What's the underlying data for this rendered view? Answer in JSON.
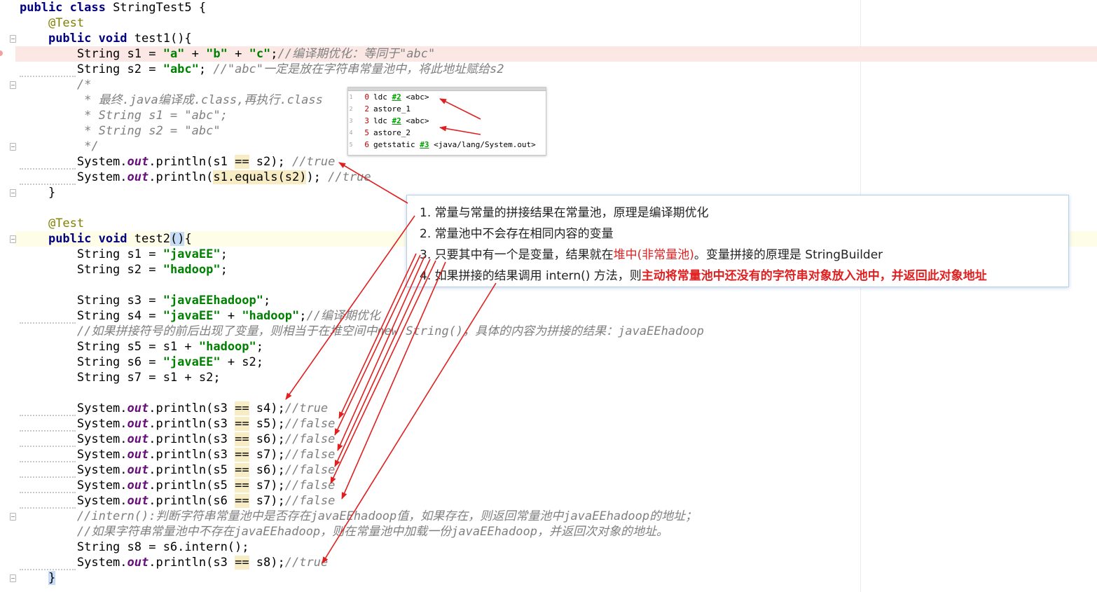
{
  "editor": {
    "lines": [
      [
        [
          "kw",
          "public class "
        ],
        [
          "p",
          "StringTest5 {"
        ]
      ],
      [
        [
          "p",
          "    "
        ],
        [
          "ann",
          "@Test"
        ]
      ],
      [
        [
          "p",
          "    "
        ],
        [
          "kw",
          "public void "
        ],
        [
          "p",
          "test1(){"
        ]
      ],
      [
        [
          "p",
          "        String s1 = "
        ],
        [
          "str",
          "\"a\""
        ],
        [
          "p",
          " + "
        ],
        [
          "str",
          "\"b\""
        ],
        [
          "p",
          " + "
        ],
        [
          "str",
          "\"c\""
        ],
        [
          "p",
          ";"
        ],
        [
          "cmt",
          "//编译期优化：等同于\"abc\""
        ]
      ],
      [
        [
          "p",
          "        String s2 = "
        ],
        [
          "str",
          "\"abc\""
        ],
        [
          "p",
          "; "
        ],
        [
          "cmt",
          "//\"abc\"一定是放在字符串常量池中，将此地址赋给s2"
        ]
      ],
      [
        [
          "cmt",
          "        /*"
        ]
      ],
      [
        [
          "cmt",
          "         * 最终.java编译成.class,再执行.class"
        ]
      ],
      [
        [
          "cmt",
          "         * String s1 = \"abc\";"
        ]
      ],
      [
        [
          "cmt",
          "         * String s2 = \"abc\""
        ]
      ],
      [
        [
          "cmt",
          "         */"
        ]
      ],
      [
        [
          "p",
          "        System."
        ],
        [
          "fld",
          "out"
        ],
        [
          "p",
          ".println(s1 "
        ],
        [
          "eq",
          "=="
        ],
        [
          "p",
          " s2); "
        ],
        [
          "cmt",
          "//true"
        ]
      ],
      [
        [
          "p",
          "        System."
        ],
        [
          "fld",
          "out"
        ],
        [
          "p",
          ".println("
        ],
        [
          "eq",
          "s1.equals(s2)"
        ],
        [
          "p",
          "); "
        ],
        [
          "cmt",
          "//true"
        ]
      ],
      [
        [
          "p",
          "    }"
        ]
      ],
      [
        [
          "p",
          ""
        ]
      ],
      [
        [
          "p",
          "    "
        ],
        [
          "ann",
          "@Test"
        ]
      ],
      [
        [
          "p",
          "    "
        ],
        [
          "kw",
          "public void "
        ],
        [
          "p",
          "test2"
        ],
        [
          "brc",
          "()"
        ],
        [
          "p",
          "{"
        ]
      ],
      [
        [
          "p",
          "        String s1 = "
        ],
        [
          "str",
          "\"javaEE\""
        ],
        [
          "p",
          ";"
        ]
      ],
      [
        [
          "p",
          "        String s2 = "
        ],
        [
          "str",
          "\"hadoop\""
        ],
        [
          "p",
          ";"
        ]
      ],
      [
        [
          "p",
          ""
        ]
      ],
      [
        [
          "p",
          "        String s3 = "
        ],
        [
          "str",
          "\"javaEEhadoop\""
        ],
        [
          "p",
          ";"
        ]
      ],
      [
        [
          "p",
          "        String s4 = "
        ],
        [
          "str",
          "\"javaEE\""
        ],
        [
          "p",
          " + "
        ],
        [
          "str",
          "\"hadoop\""
        ],
        [
          "p",
          ";"
        ],
        [
          "cmt",
          "//编译期优化"
        ]
      ],
      [
        [
          "cmt",
          "        //如果拼接符号的前后出现了变量，则相当于在堆空间中new String()，具体的内容为拼接的结果：javaEEhadoop"
        ]
      ],
      [
        [
          "p",
          "        String s5 = s1 + "
        ],
        [
          "str",
          "\"hadoop\""
        ],
        [
          "p",
          ";"
        ]
      ],
      [
        [
          "p",
          "        String s6 = "
        ],
        [
          "str",
          "\"javaEE\""
        ],
        [
          "p",
          " + s2;"
        ]
      ],
      [
        [
          "p",
          "        String s7 = s1 + s2;"
        ]
      ],
      [
        [
          "p",
          ""
        ]
      ],
      [
        [
          "p",
          "        System."
        ],
        [
          "fld",
          "out"
        ],
        [
          "p",
          ".println(s3 "
        ],
        [
          "eq",
          "=="
        ],
        [
          "p",
          " s4);"
        ],
        [
          "cmt",
          "//true"
        ]
      ],
      [
        [
          "p",
          "        System."
        ],
        [
          "fld",
          "out"
        ],
        [
          "p",
          ".println(s3 "
        ],
        [
          "eq",
          "=="
        ],
        [
          "p",
          " s5);"
        ],
        [
          "cmt",
          "//false"
        ]
      ],
      [
        [
          "p",
          "        System."
        ],
        [
          "fld",
          "out"
        ],
        [
          "p",
          ".println(s3 "
        ],
        [
          "eq",
          "=="
        ],
        [
          "p",
          " s6);"
        ],
        [
          "cmt",
          "//false"
        ]
      ],
      [
        [
          "p",
          "        System."
        ],
        [
          "fld",
          "out"
        ],
        [
          "p",
          ".println(s3 "
        ],
        [
          "eq",
          "=="
        ],
        [
          "p",
          " s7);"
        ],
        [
          "cmt",
          "//false"
        ]
      ],
      [
        [
          "p",
          "        System."
        ],
        [
          "fld",
          "out"
        ],
        [
          "p",
          ".println(s5 "
        ],
        [
          "eq",
          "=="
        ],
        [
          "p",
          " s6);"
        ],
        [
          "cmt",
          "//false"
        ]
      ],
      [
        [
          "p",
          "        System."
        ],
        [
          "fld",
          "out"
        ],
        [
          "p",
          ".println(s5 "
        ],
        [
          "eq",
          "=="
        ],
        [
          "p",
          " s7);"
        ],
        [
          "cmt",
          "//false"
        ]
      ],
      [
        [
          "p",
          "        System."
        ],
        [
          "fld",
          "out"
        ],
        [
          "p",
          ".println(s6 "
        ],
        [
          "eq",
          "=="
        ],
        [
          "p",
          " s7);"
        ],
        [
          "cmt",
          "//false"
        ]
      ],
      [
        [
          "cmt",
          "        //intern():判断字符串常量池中是否存在javaEEhadoop值，如果存在，则返回常量池中javaEEhadoop的地址；"
        ]
      ],
      [
        [
          "cmt",
          "        //如果字符串常量池中不存在javaEEhadoop，则在常量池中加载一份javaEEhadoop，并返回次对象的地址。"
        ]
      ],
      [
        [
          "p",
          "        String s8 = s6.intern();"
        ]
      ],
      [
        [
          "p",
          "        System."
        ],
        [
          "fld",
          "out"
        ],
        [
          "p",
          ".println(s3 "
        ],
        [
          "eq",
          "=="
        ],
        [
          "p",
          " s8);"
        ],
        [
          "cmt",
          "//true"
        ]
      ],
      [
        [
          "p",
          "    "
        ],
        [
          "brc",
          "}"
        ]
      ]
    ]
  },
  "bytecode": {
    "rows": [
      {
        "line": "1",
        "offset": "0",
        "instr": "ldc ",
        "ref": "#2",
        "arg": " <abc>"
      },
      {
        "line": "2",
        "offset": "2",
        "instr": "astore_1",
        "ref": "",
        "arg": ""
      },
      {
        "line": "3",
        "offset": "3",
        "instr": "ldc ",
        "ref": "#2",
        "arg": " <abc>"
      },
      {
        "line": "4",
        "offset": "5",
        "instr": "astore_2",
        "ref": "",
        "arg": ""
      },
      {
        "line": "5",
        "offset": "6",
        "instr": "getstatic ",
        "ref": "#3",
        "arg": " <java/lang/System.out>"
      }
    ]
  },
  "notes": {
    "item1": "1. 常量与常量的拼接结果在常量池，原理是编译期优化",
    "item2": "2. 常量池中不会存在相同内容的变量",
    "item3_a": "3. 只要其中有一个是变量，结果就在",
    "item3_red": "堆中(非常量池)",
    "item3_b": "。变量拼接的原理是 StringBuilder",
    "item4_a": "4. 如果拼接的结果调用 intern() 方法，则",
    "item4_red": "主动将常量池中还没有的字符串对象放入池中，并返回此对象地址"
  },
  "colors": {
    "keyword": "#000080",
    "string": "#008000",
    "comment": "#808080",
    "annotation": "#808000",
    "field": "#660e7a",
    "arrow": "#e02020"
  }
}
